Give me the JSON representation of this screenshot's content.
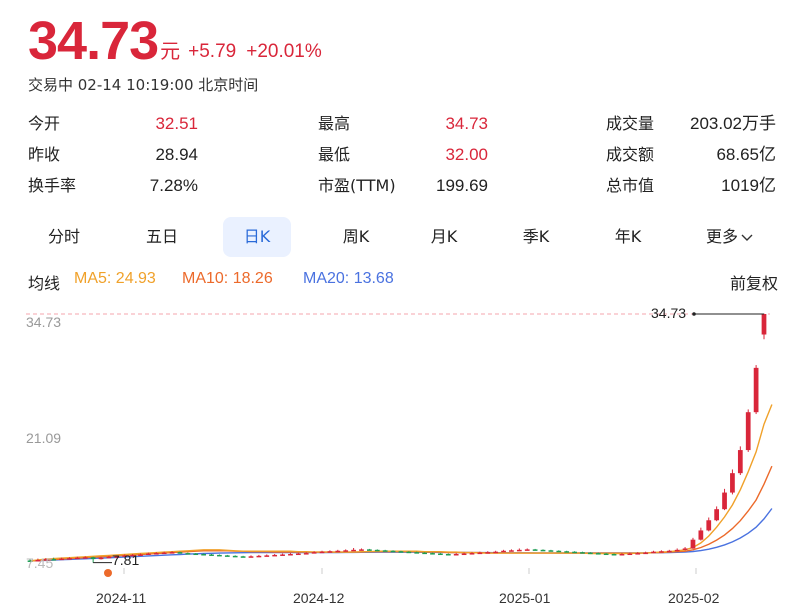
{
  "quote": {
    "price": "34.73",
    "unit": "元",
    "change": "+5.79",
    "change_pct": "+20.01%",
    "status": "交易中 02-14 10:19:00 北京时间"
  },
  "stats": [
    [
      {
        "label": "今开",
        "value": "32.51",
        "color": "#d9263a"
      },
      {
        "label": "最高",
        "value": "34.73",
        "color": "#d9263a"
      },
      {
        "label": "成交量",
        "value": "203.02万手",
        "color": "#222222"
      }
    ],
    [
      {
        "label": "昨收",
        "value": "28.94",
        "color": "#222222"
      },
      {
        "label": "最低",
        "value": "32.00",
        "color": "#d9263a"
      },
      {
        "label": "成交额",
        "value": "68.65亿",
        "color": "#222222"
      }
    ],
    [
      {
        "label": "换手率",
        "value": "7.28%",
        "color": "#222222"
      },
      {
        "label": "市盈(TTM)",
        "value": "199.69",
        "color": "#222222"
      },
      {
        "label": "总市值",
        "value": "1019亿",
        "color": "#222222"
      }
    ]
  ],
  "tabs": [
    "分时",
    "五日",
    "日K",
    "周K",
    "月K",
    "季K",
    "年K",
    "更多"
  ],
  "active_tab": "日K",
  "ma": {
    "label": "均线",
    "ma5": "MA5: 24.93",
    "ma10": "MA10: 18.26",
    "ma20": "MA20: 13.68",
    "adjust": "前复权"
  },
  "colors": {
    "up": "#d9263a",
    "down": "#1f9d55",
    "ma5": "#f0a12a",
    "ma10": "#ec6a2b",
    "ma20": "#4a72e0",
    "accent": "#2a6ad8"
  },
  "chart_data": {
    "type": "candlestick",
    "y_ticks": [
      "34.73",
      "21.09",
      "7.45"
    ],
    "ylim": [
      7.45,
      34.73
    ],
    "x_ticks": [
      "2024-11",
      "2024-12",
      "2025-01",
      "2025-02"
    ],
    "high_marker": "34.73",
    "low_marker": "7.81",
    "candles": [
      [
        8.05,
        8.0,
        8.2,
        7.9
      ],
      [
        8.0,
        8.1,
        8.25,
        7.95
      ],
      [
        8.1,
        8.2,
        8.3,
        8.05
      ],
      [
        8.2,
        8.15,
        8.35,
        8.1
      ],
      [
        8.15,
        8.25,
        8.35,
        8.1
      ],
      [
        8.25,
        8.3,
        8.4,
        8.2
      ],
      [
        8.3,
        8.35,
        8.45,
        8.25
      ],
      [
        8.35,
        8.4,
        8.5,
        8.3
      ],
      [
        8.4,
        8.2,
        8.45,
        7.81
      ],
      [
        8.2,
        8.35,
        8.45,
        8.15
      ],
      [
        8.35,
        8.45,
        8.55,
        8.3
      ],
      [
        8.45,
        8.5,
        8.6,
        8.4
      ],
      [
        8.5,
        8.6,
        8.7,
        8.45
      ],
      [
        8.6,
        8.65,
        8.75,
        8.55
      ],
      [
        8.65,
        8.7,
        8.8,
        8.6
      ],
      [
        8.7,
        8.8,
        8.9,
        8.65
      ],
      [
        8.8,
        8.85,
        8.95,
        8.75
      ],
      [
        8.85,
        8.9,
        9.0,
        8.8
      ],
      [
        8.9,
        8.95,
        9.05,
        8.85
      ],
      [
        8.95,
        8.85,
        9.0,
        8.8
      ],
      [
        8.85,
        8.8,
        8.9,
        8.75
      ],
      [
        8.8,
        8.75,
        8.85,
        8.7
      ],
      [
        8.75,
        8.7,
        8.8,
        8.65
      ],
      [
        8.7,
        8.65,
        8.75,
        8.6
      ],
      [
        8.65,
        8.6,
        8.7,
        8.55
      ],
      [
        8.6,
        8.55,
        8.65,
        8.5
      ],
      [
        8.55,
        8.5,
        8.6,
        8.45
      ],
      [
        8.5,
        8.45,
        8.55,
        8.4
      ],
      [
        8.45,
        8.5,
        8.6,
        8.4
      ],
      [
        8.5,
        8.55,
        8.65,
        8.45
      ],
      [
        8.55,
        8.6,
        8.7,
        8.5
      ],
      [
        8.6,
        8.65,
        8.75,
        8.55
      ],
      [
        8.65,
        8.7,
        8.8,
        8.6
      ],
      [
        8.7,
        8.75,
        8.85,
        8.65
      ],
      [
        8.75,
        8.8,
        8.9,
        8.7
      ],
      [
        8.8,
        8.85,
        8.95,
        8.75
      ],
      [
        8.85,
        8.95,
        9.05,
        8.8
      ],
      [
        8.95,
        9.0,
        9.1,
        8.9
      ],
      [
        9.0,
        9.05,
        9.15,
        8.95
      ],
      [
        9.05,
        9.1,
        9.2,
        9.0
      ],
      [
        9.1,
        9.15,
        9.25,
        9.05
      ],
      [
        9.15,
        9.2,
        9.4,
        9.1
      ],
      [
        9.2,
        9.25,
        9.35,
        9.15
      ],
      [
        9.25,
        9.2,
        9.3,
        9.15
      ],
      [
        9.2,
        9.15,
        9.25,
        9.1
      ],
      [
        9.15,
        9.1,
        9.2,
        9.05
      ],
      [
        9.1,
        9.05,
        9.15,
        9.0
      ],
      [
        9.05,
        9.0,
        9.1,
        8.95
      ],
      [
        9.0,
        8.95,
        9.05,
        8.9
      ],
      [
        8.95,
        8.9,
        9.0,
        8.85
      ],
      [
        8.9,
        8.85,
        8.95,
        8.8
      ],
      [
        8.85,
        8.8,
        8.9,
        8.75
      ],
      [
        8.8,
        8.75,
        8.85,
        8.7
      ],
      [
        8.75,
        8.7,
        8.8,
        8.65
      ],
      [
        8.7,
        8.75,
        8.85,
        8.65
      ],
      [
        8.75,
        8.8,
        8.9,
        8.7
      ],
      [
        8.8,
        8.85,
        8.95,
        8.75
      ],
      [
        8.85,
        8.9,
        9.0,
        8.8
      ],
      [
        8.9,
        8.95,
        9.05,
        8.85
      ],
      [
        8.95,
        9.0,
        9.1,
        8.9
      ],
      [
        9.0,
        9.1,
        9.2,
        8.95
      ],
      [
        9.1,
        9.15,
        9.25,
        9.05
      ],
      [
        9.15,
        9.2,
        9.35,
        9.1
      ],
      [
        9.2,
        9.25,
        9.35,
        9.15
      ],
      [
        9.25,
        9.2,
        9.3,
        9.15
      ],
      [
        9.2,
        9.15,
        9.25,
        9.1
      ],
      [
        9.15,
        9.1,
        9.2,
        9.05
      ],
      [
        9.1,
        9.05,
        9.15,
        9.0
      ],
      [
        9.05,
        9.0,
        9.1,
        8.95
      ],
      [
        9.0,
        8.95,
        9.05,
        8.9
      ],
      [
        8.95,
        8.9,
        9.0,
        8.85
      ],
      [
        8.9,
        8.85,
        8.95,
        8.8
      ],
      [
        8.85,
        8.8,
        8.9,
        8.75
      ],
      [
        8.8,
        8.75,
        8.85,
        8.7
      ],
      [
        8.75,
        8.7,
        8.8,
        8.65
      ],
      [
        8.7,
        8.75,
        8.85,
        8.65
      ],
      [
        8.75,
        8.8,
        8.9,
        8.7
      ],
      [
        8.8,
        8.85,
        8.95,
        8.75
      ],
      [
        8.85,
        8.9,
        9.0,
        8.8
      ],
      [
        8.9,
        9.0,
        9.1,
        8.85
      ],
      [
        9.0,
        9.05,
        9.15,
        8.95
      ],
      [
        9.05,
        9.1,
        9.2,
        9.0
      ],
      [
        9.1,
        9.2,
        9.35,
        9.05
      ],
      [
        9.2,
        9.35,
        9.5,
        9.15
      ],
      [
        9.35,
        10.3,
        10.5,
        9.3
      ],
      [
        10.3,
        11.3,
        11.6,
        10.2
      ],
      [
        11.3,
        12.4,
        12.7,
        11.2
      ],
      [
        12.4,
        13.6,
        13.9,
        12.3
      ],
      [
        13.6,
        15.4,
        15.8,
        13.5
      ],
      [
        15.4,
        17.5,
        17.9,
        15.2
      ],
      [
        17.5,
        20.0,
        20.4,
        17.3
      ],
      [
        20.0,
        24.1,
        24.4,
        19.8
      ],
      [
        24.1,
        28.9,
        29.2,
        23.9
      ],
      [
        32.51,
        34.73,
        34.73,
        32.0
      ]
    ],
    "ma5": [
      8.0,
      8.1,
      8.2,
      8.25,
      8.3,
      8.35,
      8.4,
      8.45,
      8.5,
      8.55,
      8.6,
      8.65,
      8.7,
      8.75,
      8.8,
      8.85,
      8.9,
      8.95,
      9.0,
      9.05,
      9.1,
      9.15,
      9.2,
      9.2,
      9.2,
      9.15,
      9.1,
      9.05,
      9.05,
      9.05,
      9.05,
      9.05,
      9.05,
      9.05,
      9.0,
      9.0,
      8.95,
      8.95,
      8.95,
      8.95,
      8.95,
      8.95,
      9.0,
      9.0,
      9.05,
      9.05,
      9.05,
      9.05,
      9.05,
      9.05,
      9.0,
      9.0,
      9.0,
      8.95,
      8.95,
      8.9,
      8.9,
      8.85,
      8.85,
      8.85,
      8.85,
      8.85,
      8.85,
      8.85,
      8.85,
      8.85,
      8.85,
      8.85,
      8.85,
      8.85,
      8.85,
      8.8,
      8.8,
      8.8,
      8.8,
      8.8,
      8.8,
      8.85,
      8.85,
      8.9,
      8.95,
      9.0,
      9.1,
      9.2,
      9.45,
      9.95,
      10.7,
      11.65,
      12.75,
      14.05,
      15.7,
      17.65,
      19.8,
      22.8,
      24.93
    ],
    "ma10": [
      8.0,
      8.05,
      8.1,
      8.15,
      8.2,
      8.25,
      8.3,
      8.35,
      8.4,
      8.45,
      8.5,
      8.55,
      8.6,
      8.65,
      8.7,
      8.75,
      8.8,
      8.85,
      8.9,
      8.95,
      9.0,
      9.05,
      9.1,
      9.1,
      9.1,
      9.1,
      9.05,
      9.05,
      9.0,
      9.0,
      9.0,
      8.95,
      8.95,
      8.95,
      8.95,
      8.95,
      8.95,
      8.95,
      8.95,
      8.95,
      8.95,
      8.95,
      8.95,
      9.0,
      9.0,
      9.0,
      9.0,
      9.0,
      9.0,
      9.0,
      8.95,
      8.95,
      8.95,
      8.9,
      8.9,
      8.9,
      8.9,
      8.9,
      8.85,
      8.85,
      8.85,
      8.85,
      8.85,
      8.85,
      8.85,
      8.85,
      8.85,
      8.85,
      8.85,
      8.85,
      8.85,
      8.85,
      8.85,
      8.85,
      8.85,
      8.85,
      8.85,
      8.85,
      8.85,
      8.9,
      8.9,
      8.95,
      9.0,
      9.05,
      9.2,
      9.45,
      9.8,
      10.25,
      10.8,
      11.5,
      12.35,
      13.4,
      14.6,
      16.3,
      18.26
    ],
    "ma20": [
      8.0,
      8.03,
      8.06,
      8.1,
      8.13,
      8.16,
      8.2,
      8.23,
      8.27,
      8.3,
      8.34,
      8.38,
      8.42,
      8.46,
      8.5,
      8.54,
      8.58,
      8.62,
      8.66,
      8.7,
      8.74,
      8.77,
      8.8,
      8.83,
      8.85,
      8.87,
      8.88,
      8.89,
      8.9,
      8.9,
      8.9,
      8.9,
      8.9,
      8.9,
      8.9,
      8.9,
      8.9,
      8.9,
      8.91,
      8.91,
      8.92,
      8.92,
      8.93,
      8.93,
      8.94,
      8.94,
      8.94,
      8.94,
      8.94,
      8.94,
      8.93,
      8.93,
      8.92,
      8.92,
      8.91,
      8.91,
      8.9,
      8.9,
      8.9,
      8.89,
      8.89,
      8.88,
      8.88,
      8.88,
      8.87,
      8.87,
      8.87,
      8.86,
      8.86,
      8.86,
      8.86,
      8.86,
      8.86,
      8.86,
      8.86,
      8.86,
      8.86,
      8.86,
      8.87,
      8.88,
      8.89,
      8.91,
      8.93,
      8.96,
      9.02,
      9.12,
      9.27,
      9.47,
      9.73,
      10.06,
      10.48,
      11.0,
      11.65,
      12.55,
      13.68
    ]
  }
}
